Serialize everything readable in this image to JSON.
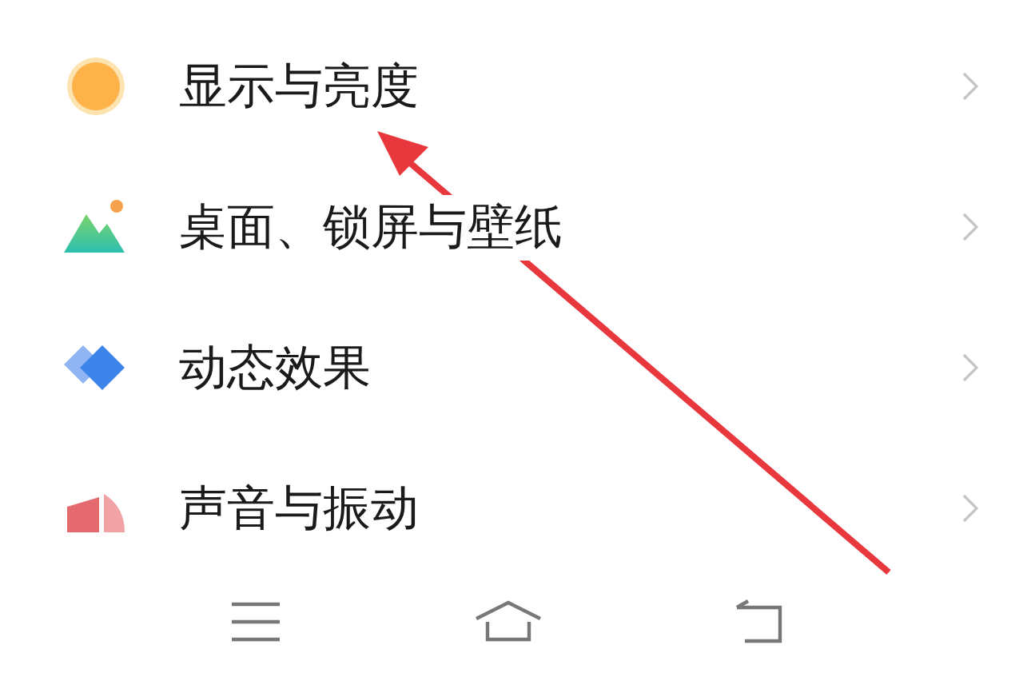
{
  "settings_list": [
    {
      "kind": "display",
      "label": "显示与亮度"
    },
    {
      "kind": "wallpaper",
      "label": "桌面、锁屏与壁纸"
    },
    {
      "kind": "motion",
      "label": "动态效果"
    },
    {
      "kind": "sound",
      "label": "声音与振动"
    }
  ],
  "nav_bar": [
    {
      "kind": "menu"
    },
    {
      "kind": "home"
    },
    {
      "kind": "back"
    }
  ],
  "annotation": {
    "kind": "arrow"
  }
}
